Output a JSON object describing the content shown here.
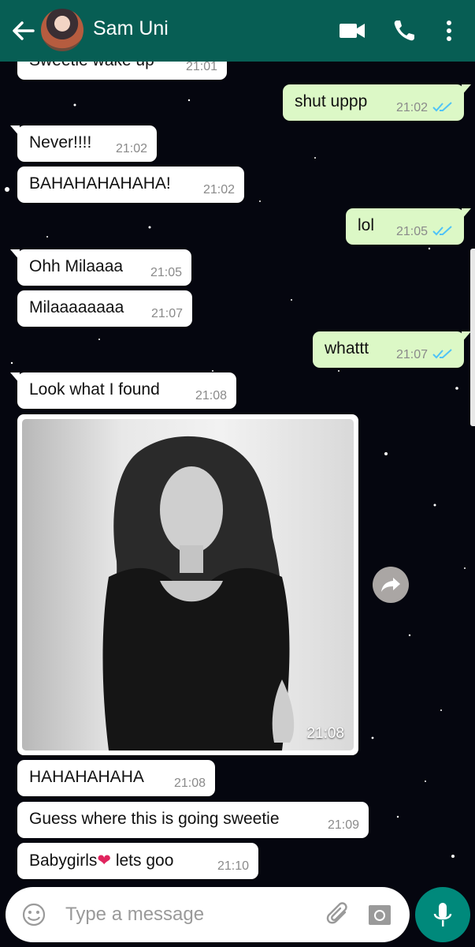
{
  "header": {
    "title": "Sam Uni",
    "back_icon": "arrow-left-icon",
    "video_icon": "video-camera-icon",
    "call_icon": "phone-icon",
    "menu_icon": "more-vertical-icon"
  },
  "messages": [
    {
      "direction": "in",
      "text": "Sweetie wake up",
      "time": "21:01"
    },
    {
      "direction": "out",
      "text": "shut uppp",
      "time": "21:02",
      "status": "read"
    },
    {
      "direction": "in",
      "text": "Never!!!!",
      "time": "21:02"
    },
    {
      "direction": "in",
      "text": "BAHAHAHAHAHA!",
      "time": "21:02"
    },
    {
      "direction": "out",
      "text": "lol",
      "time": "21:05",
      "status": "read"
    },
    {
      "direction": "in",
      "text": "Ohh Milaaaa",
      "time": "21:05"
    },
    {
      "direction": "in",
      "text": "Milaaaaaaaa",
      "time": "21:07"
    },
    {
      "direction": "out",
      "text": "whattt",
      "time": "21:07",
      "status": "read"
    },
    {
      "direction": "in",
      "text": "Look what I found",
      "time": "21:08"
    },
    {
      "direction": "in",
      "type": "image",
      "time": "21:08"
    },
    {
      "direction": "in",
      "text": "HAHAHAHAHA",
      "time": "21:08"
    },
    {
      "direction": "in",
      "text": "Guess where this is going sweetie",
      "time": "21:09"
    },
    {
      "direction": "in",
      "text": "Babygirls",
      "emoji": "❤",
      "text_after": " lets goo",
      "time": "21:10"
    }
  ],
  "composer": {
    "placeholder": "Type a message",
    "emoji_icon": "smiley-icon",
    "attach_icon": "paperclip-icon",
    "camera_icon": "camera-icon",
    "mic_icon": "microphone-icon"
  },
  "colors": {
    "header": "#075e54",
    "outgoing_bubble": "#dcf8c6",
    "incoming_bubble": "#ffffff",
    "read_ticks": "#4fc3f7",
    "mic_button": "#00897b",
    "background": "#05060f"
  }
}
